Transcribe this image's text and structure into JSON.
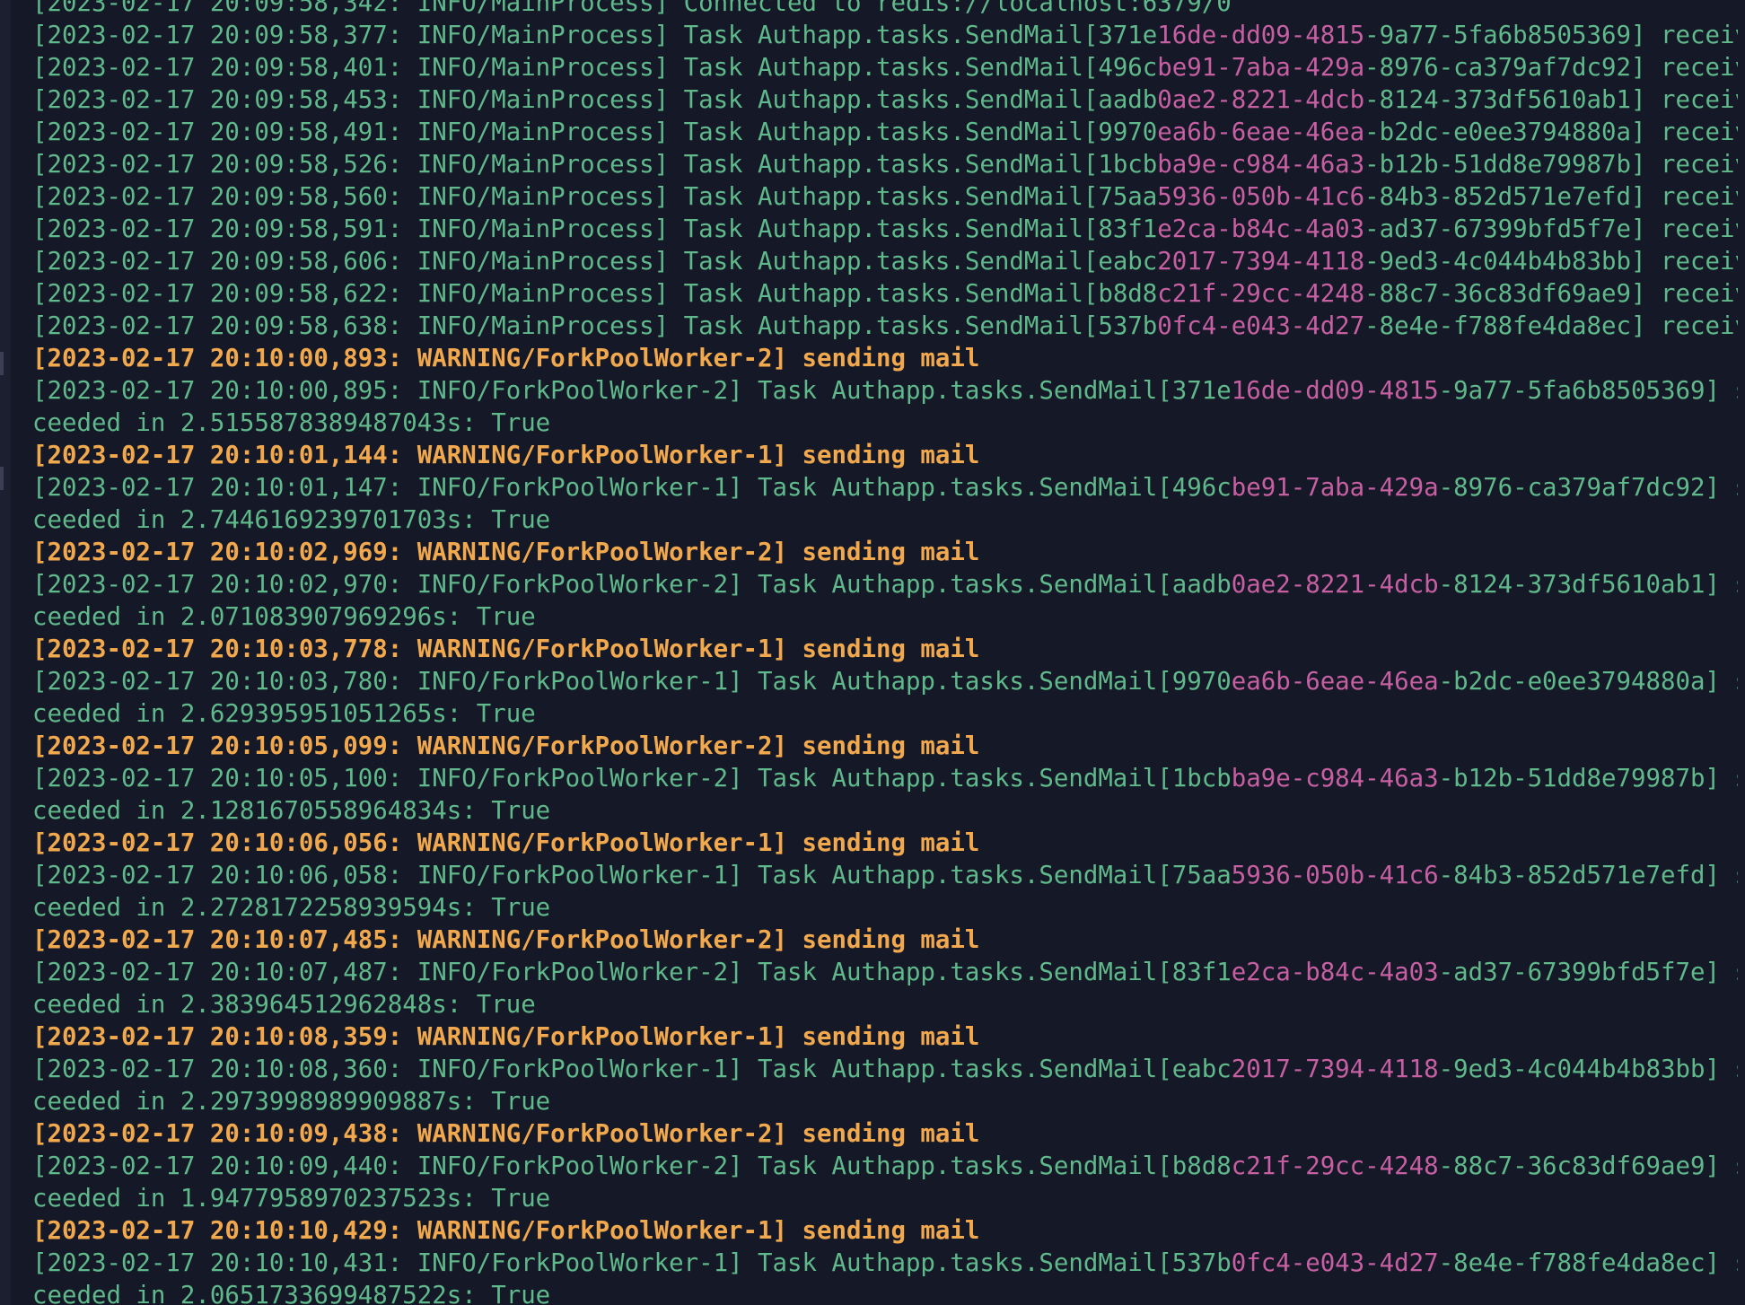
{
  "terminal": {
    "partial_top_line": "[2023-02-17 20:09:58,342: INFO/MainProcess] Connected to redis://localhost:6379/0",
    "received_lines": [
      {
        "prefix": "[2023-02-17 20:09:58,377: INFO/MainProcess] Task Authapp.tasks.SendMail[",
        "id_a": "371e",
        "id_b": "16de-dd09-4815",
        "id_c": "-9a77-5fa6b8505369",
        "suffix": "] received"
      },
      {
        "prefix": "[2023-02-17 20:09:58,401: INFO/MainProcess] Task Authapp.tasks.SendMail[",
        "id_a": "496c",
        "id_b": "be91-7aba-429a",
        "id_c": "-8976-ca379af7dc92",
        "suffix": "] received"
      },
      {
        "prefix": "[2023-02-17 20:09:58,453: INFO/MainProcess] Task Authapp.tasks.SendMail[",
        "id_a": "aadb",
        "id_b": "0ae2-8221-4dcb",
        "id_c": "-8124-373df5610ab1",
        "suffix": "] received"
      },
      {
        "prefix": "[2023-02-17 20:09:58,491: INFO/MainProcess] Task Authapp.tasks.SendMail[",
        "id_a": "9970",
        "id_b": "ea6b-6eae-46ea",
        "id_c": "-b2dc-e0ee3794880a",
        "suffix": "] received"
      },
      {
        "prefix": "[2023-02-17 20:09:58,526: INFO/MainProcess] Task Authapp.tasks.SendMail[",
        "id_a": "1bcb",
        "id_b": "ba9e-c984-46a3",
        "id_c": "-b12b-51dd8e79987b",
        "suffix": "] received"
      },
      {
        "prefix": "[2023-02-17 20:09:58,560: INFO/MainProcess] Task Authapp.tasks.SendMail[",
        "id_a": "75aa",
        "id_b": "5936-050b-41c6",
        "id_c": "-84b3-852d571e7efd",
        "suffix": "] received"
      },
      {
        "prefix": "[2023-02-17 20:09:58,591: INFO/MainProcess] Task Authapp.tasks.SendMail[",
        "id_a": "83f1",
        "id_b": "e2ca-b84c-4a03",
        "id_c": "-ad37-67399bfd5f7e",
        "suffix": "] received"
      },
      {
        "prefix": "[2023-02-17 20:09:58,606: INFO/MainProcess] Task Authapp.tasks.SendMail[",
        "id_a": "eabc",
        "id_b": "2017-7394-4118",
        "id_c": "-9ed3-4c044b4b83bb",
        "suffix": "] received"
      },
      {
        "prefix": "[2023-02-17 20:09:58,622: INFO/MainProcess] Task Authapp.tasks.SendMail[",
        "id_a": "b8d8",
        "id_b": "c21f-29cc-4248",
        "id_c": "-88c7-36c83df69ae9",
        "suffix": "] received"
      },
      {
        "prefix": "[2023-02-17 20:09:58,638: INFO/MainProcess] Task Authapp.tasks.SendMail[",
        "id_a": "537b",
        "id_b": "0fc4-e043-4d27",
        "id_c": "-8e4e-f788fe4da8ec",
        "suffix": "] received"
      }
    ],
    "worker_blocks": [
      {
        "warning": "[2023-02-17 20:10:00,893: WARNING/ForkPoolWorker-2] sending mail",
        "prefix": "[2023-02-17 20:10:00,895: INFO/ForkPoolWorker-2] Task Authapp.tasks.SendMail[",
        "id_a": "371e",
        "id_b": "16de-dd09-4815",
        "id_c": "-9a77-5fa6b8505369",
        "suffix": "] suc",
        "cont": "ceeded in 2.5155878389487043s: True"
      },
      {
        "warning": "[2023-02-17 20:10:01,144: WARNING/ForkPoolWorker-1] sending mail",
        "prefix": "[2023-02-17 20:10:01,147: INFO/ForkPoolWorker-1] Task Authapp.tasks.SendMail[",
        "id_a": "496c",
        "id_b": "be91-7aba-429a",
        "id_c": "-8976-ca379af7dc92",
        "suffix": "] suc",
        "cont": "ceeded in 2.7446169239701703s: True"
      },
      {
        "warning": "[2023-02-17 20:10:02,969: WARNING/ForkPoolWorker-2] sending mail",
        "prefix": "[2023-02-17 20:10:02,970: INFO/ForkPoolWorker-2] Task Authapp.tasks.SendMail[",
        "id_a": "aadb",
        "id_b": "0ae2-8221-4dcb",
        "id_c": "-8124-373df5610ab1",
        "suffix": "] suc",
        "cont": "ceeded in 2.071083907969296s: True"
      },
      {
        "warning": "[2023-02-17 20:10:03,778: WARNING/ForkPoolWorker-1] sending mail",
        "prefix": "[2023-02-17 20:10:03,780: INFO/ForkPoolWorker-1] Task Authapp.tasks.SendMail[",
        "id_a": "9970",
        "id_b": "ea6b-6eae-46ea",
        "id_c": "-b2dc-e0ee3794880a",
        "suffix": "] suc",
        "cont": "ceeded in 2.629395951051265s: True"
      },
      {
        "warning": "[2023-02-17 20:10:05,099: WARNING/ForkPoolWorker-2] sending mail",
        "prefix": "[2023-02-17 20:10:05,100: INFO/ForkPoolWorker-2] Task Authapp.tasks.SendMail[",
        "id_a": "1bcb",
        "id_b": "ba9e-c984-46a3",
        "id_c": "-b12b-51dd8e79987b",
        "suffix": "] suc",
        "cont": "ceeded in 2.1281670558964834s: True"
      },
      {
        "warning": "[2023-02-17 20:10:06,056: WARNING/ForkPoolWorker-1] sending mail",
        "prefix": "[2023-02-17 20:10:06,058: INFO/ForkPoolWorker-1] Task Authapp.tasks.SendMail[",
        "id_a": "75aa",
        "id_b": "5936-050b-41c6",
        "id_c": "-84b3-852d571e7efd",
        "suffix": "] suc",
        "cont": "ceeded in 2.2728172258939594s: True"
      },
      {
        "warning": "[2023-02-17 20:10:07,485: WARNING/ForkPoolWorker-2] sending mail",
        "prefix": "[2023-02-17 20:10:07,487: INFO/ForkPoolWorker-2] Task Authapp.tasks.SendMail[",
        "id_a": "83f1",
        "id_b": "e2ca-b84c-4a03",
        "id_c": "-ad37-67399bfd5f7e",
        "suffix": "] suc",
        "cont": "ceeded in 2.383964512962848s: True"
      },
      {
        "warning": "[2023-02-17 20:10:08,359: WARNING/ForkPoolWorker-1] sending mail",
        "prefix": "[2023-02-17 20:10:08,360: INFO/ForkPoolWorker-1] Task Authapp.tasks.SendMail[",
        "id_a": "eabc",
        "id_b": "2017-7394-4118",
        "id_c": "-9ed3-4c044b4b83bb",
        "suffix": "] suc",
        "cont": "ceeded in 2.2973998989909887s: True"
      },
      {
        "warning": "[2023-02-17 20:10:09,438: WARNING/ForkPoolWorker-2] sending mail",
        "prefix": "[2023-02-17 20:10:09,440: INFO/ForkPoolWorker-2] Task Authapp.tasks.SendMail[",
        "id_a": "b8d8",
        "id_b": "c21f-29cc-4248",
        "id_c": "-88c7-36c83df69ae9",
        "suffix": "] suc",
        "cont": "ceeded in 1.9477958970237523s: True"
      },
      {
        "warning": "[2023-02-17 20:10:10,429: WARNING/ForkPoolWorker-1] sending mail",
        "prefix": "[2023-02-17 20:10:10,431: INFO/ForkPoolWorker-1] Task Authapp.tasks.SendMail[",
        "id_a": "537b",
        "id_b": "0fc4-e043-4d27",
        "id_c": "-8e4e-f788fe4da8ec",
        "suffix": "] suc",
        "cont": "ceeded in 2.0651733699487522s: True"
      }
    ]
  },
  "colors": {
    "background": "#151827",
    "info_text": "#5fb98a",
    "warning_text": "#f2a94d",
    "task_id_highlight": "#c75fa3"
  }
}
